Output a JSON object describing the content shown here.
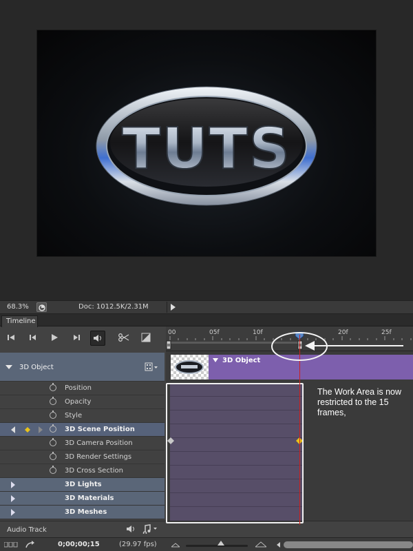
{
  "canvas": {
    "logo_text": "TUTS"
  },
  "status": {
    "zoom": "68.3%",
    "doc_size": "Doc: 1012.5K/2.31M"
  },
  "panel": {
    "tab": "Timeline"
  },
  "layer": {
    "name": "3D Object"
  },
  "properties": [
    {
      "label": "Position",
      "bold": false
    },
    {
      "label": "Opacity",
      "bold": false
    },
    {
      "label": "Style",
      "bold": false
    },
    {
      "label": "3D Scene Position",
      "bold": true
    },
    {
      "label": "3D Camera Position",
      "bold": false
    },
    {
      "label": "3D Render Settings",
      "bold": false
    },
    {
      "label": "3D Cross Section",
      "bold": false
    }
  ],
  "groups": [
    {
      "label": "3D Lights"
    },
    {
      "label": "3D Materials"
    },
    {
      "label": "3D Meshes"
    }
  ],
  "ruler": {
    "ticks": [
      "00",
      "05f",
      "10f",
      "20f",
      "25f"
    ]
  },
  "track": {
    "label": "3D Object"
  },
  "annotation": {
    "text": "The Work Area is now restricted to the 15 frames,"
  },
  "audio": {
    "label": "Audio Track"
  },
  "bottom": {
    "timecode": "0;00;00;15",
    "fps": "(29.97 fps)"
  },
  "colors": {
    "track_bar": "#7d5fad",
    "work_area": "#574e68",
    "playhead": "#cc2020",
    "keyframe_active": "#e8c21a"
  }
}
